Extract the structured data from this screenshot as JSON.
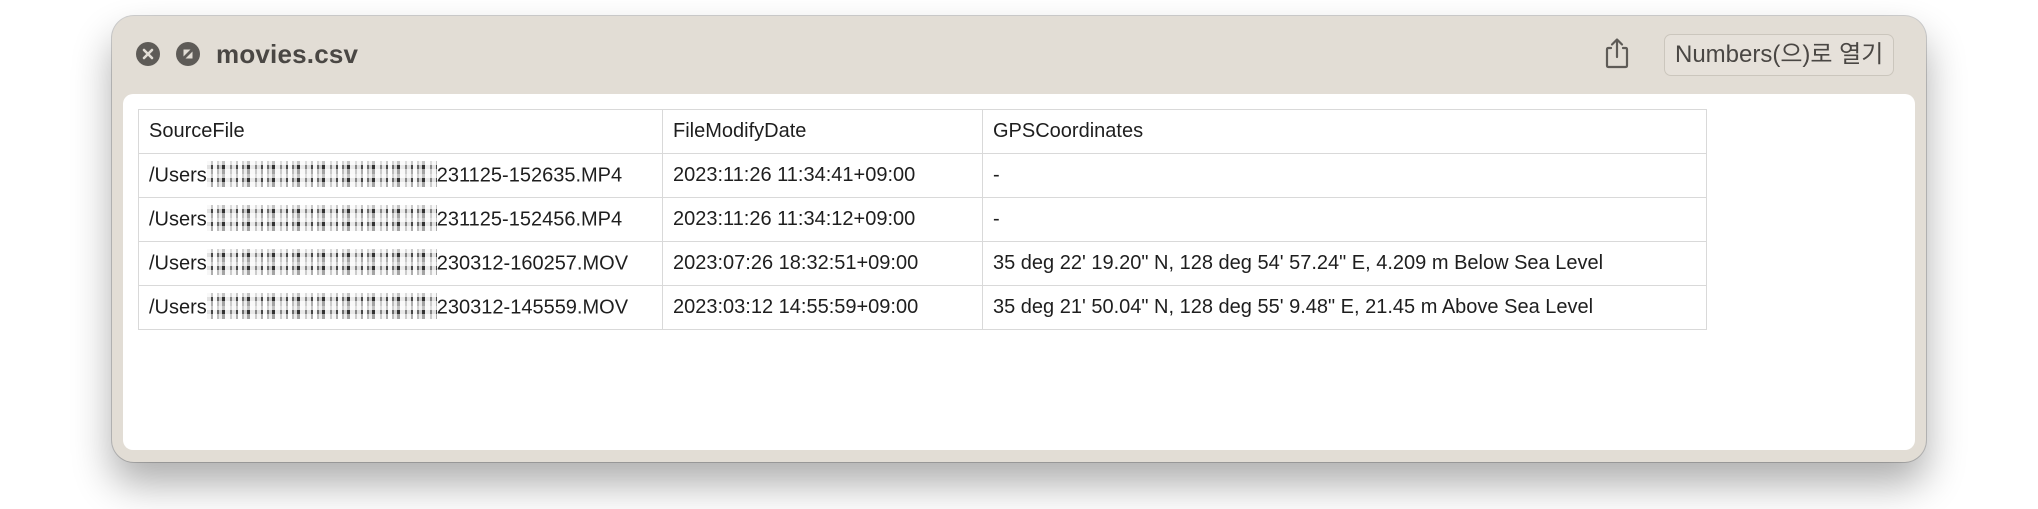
{
  "window": {
    "title": "movies.csv",
    "open_with_label": "Numbers(으)로 열기"
  },
  "icons": {
    "close": "close-icon",
    "fullscreen": "fullscreen-icon",
    "share": "share-icon"
  },
  "table": {
    "headers": [
      "SourceFile",
      "FileModifyDate",
      "GPSCoordinates"
    ],
    "rows": [
      {
        "source_prefix": "/Users",
        "source_suffix": "231125-152635.MP4",
        "date": "2023:11:26 11:34:41+09:00",
        "gps": "-"
      },
      {
        "source_prefix": "/Users",
        "source_suffix": "231125-152456.MP4",
        "date": "2023:11:26 11:34:12+09:00",
        "gps": "-"
      },
      {
        "source_prefix": "/Users",
        "source_suffix": "230312-160257.MOV",
        "date": "2023:07:26 18:32:51+09:00",
        "gps": "35 deg 22' 19.20\" N, 128 deg 54' 57.24\" E, 4.209 m Below Sea Level"
      },
      {
        "source_prefix": "/Users",
        "source_suffix": "230312-145559.MOV",
        "date": "2023:03:12 14:55:59+09:00",
        "gps": "35 deg 21' 50.04\" N, 128 deg 55' 9.48\" E, 21.45 m Above Sea Level"
      }
    ]
  },
  "colors": {
    "window_bg": "#e2ddd5",
    "control_gray": "#5e5b57",
    "title_text": "#4a4744",
    "grid_line": "#d9d9d9"
  }
}
